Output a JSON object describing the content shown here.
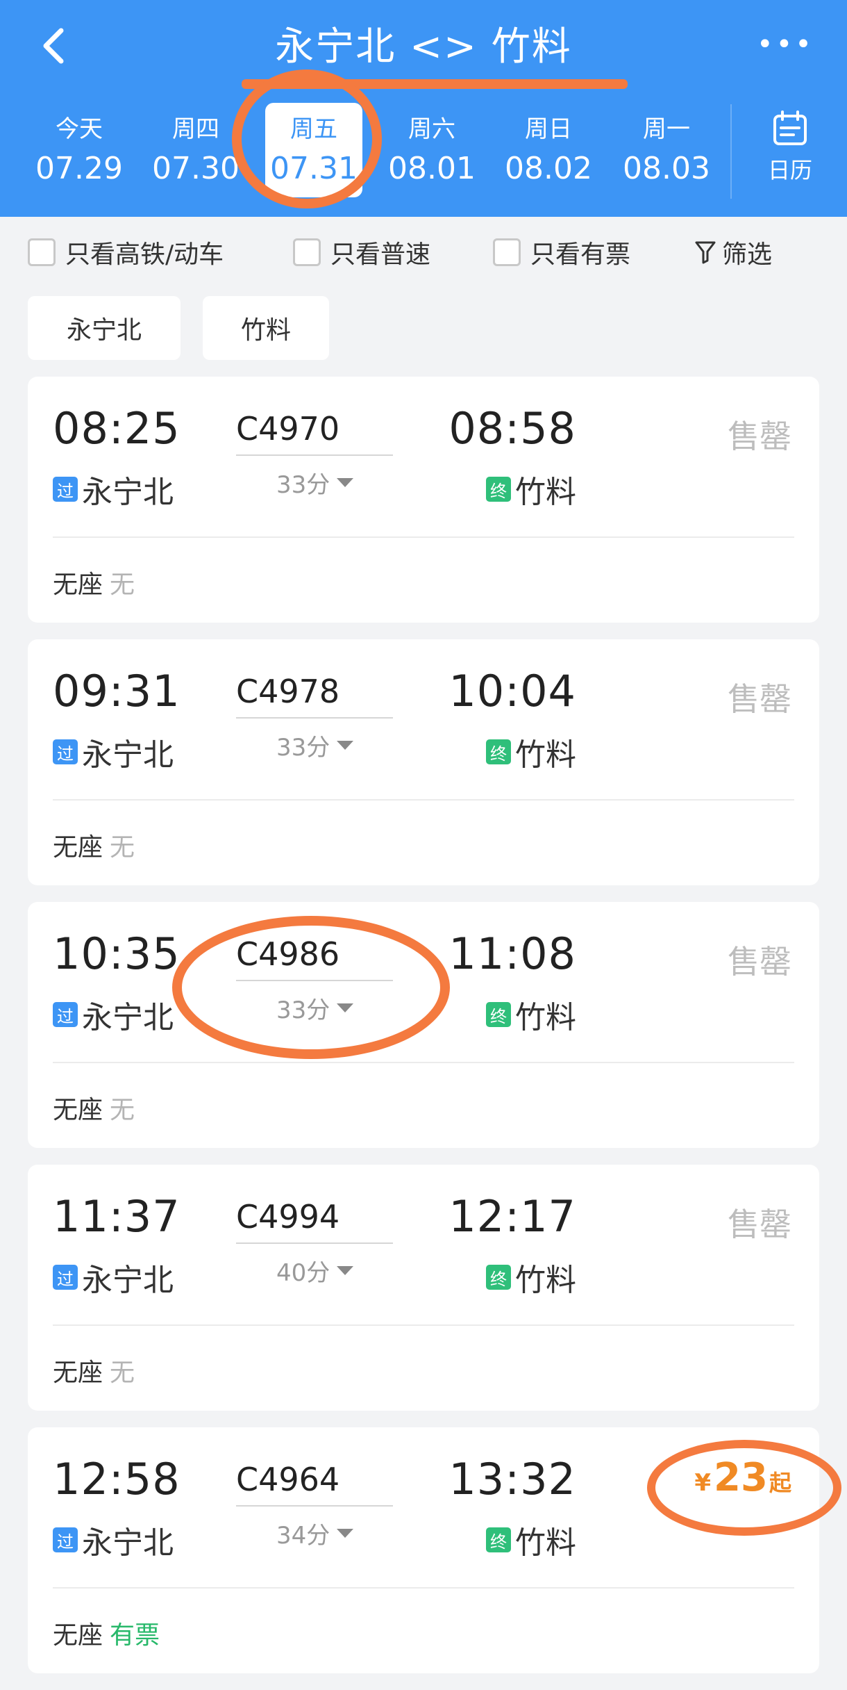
{
  "header": {
    "title": "永宁北 <> 竹料",
    "more_label": "•••",
    "accent_color": "#3d95f5",
    "dates": [
      {
        "weekday": "今天",
        "date": "07.29",
        "active": false
      },
      {
        "weekday": "周四",
        "date": "07.30",
        "active": false
      },
      {
        "weekday": "周五",
        "date": "07.31",
        "active": true
      },
      {
        "weekday": "周六",
        "date": "08.01",
        "active": false
      },
      {
        "weekday": "周日",
        "date": "08.02",
        "active": false
      },
      {
        "weekday": "周一",
        "date": "08.03",
        "active": false
      }
    ],
    "calendar_label": "日历"
  },
  "filters": {
    "items": [
      "只看高铁/动车",
      "只看普速",
      "只看有票"
    ],
    "filter_label": "筛选"
  },
  "stations": {
    "from": "永宁北",
    "to": "竹料"
  },
  "trains": [
    {
      "dep_time": "08:25",
      "train_no": "C4970",
      "duration": "33分",
      "arr_time": "08:58",
      "from_tag": "过",
      "from": "永宁北",
      "to_tag": "终",
      "to": "竹料",
      "status": "售罄",
      "seat_type": "无座",
      "seat_avail": "无"
    },
    {
      "dep_time": "09:31",
      "train_no": "C4978",
      "duration": "33分",
      "arr_time": "10:04",
      "from_tag": "过",
      "from": "永宁北",
      "to_tag": "终",
      "to": "竹料",
      "status": "售罄",
      "seat_type": "无座",
      "seat_avail": "无"
    },
    {
      "dep_time": "10:35",
      "train_no": "C4986",
      "duration": "33分",
      "arr_time": "11:08",
      "from_tag": "过",
      "from": "永宁北",
      "to_tag": "终",
      "to": "竹料",
      "status": "售罄",
      "seat_type": "无座",
      "seat_avail": "无"
    },
    {
      "dep_time": "11:37",
      "train_no": "C4994",
      "duration": "40分",
      "arr_time": "12:17",
      "from_tag": "过",
      "from": "永宁北",
      "to_tag": "终",
      "to": "竹料",
      "status": "售罄",
      "seat_type": "无座",
      "seat_avail": "无"
    },
    {
      "dep_time": "12:58",
      "train_no": "C4964",
      "duration": "34分",
      "arr_time": "13:32",
      "from_tag": "过",
      "from": "永宁北",
      "to_tag": "终",
      "to": "竹料",
      "price_symbol": "¥",
      "price_value": "23",
      "price_suffix": "起",
      "seat_type": "无座",
      "seat_avail": "有票"
    }
  ]
}
